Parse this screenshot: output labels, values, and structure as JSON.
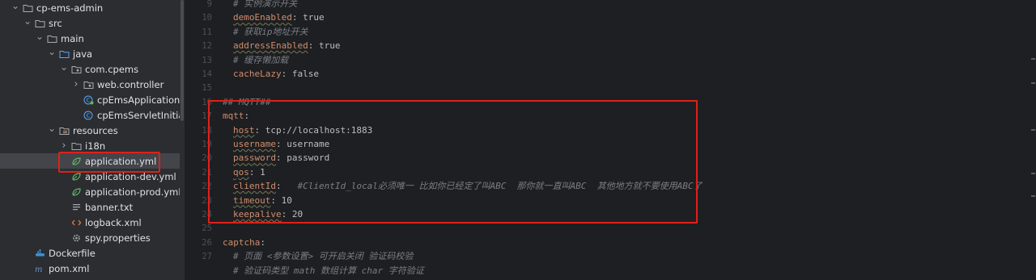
{
  "tree": {
    "items": [
      {
        "label": "cp-ems-admin",
        "depth": 0,
        "chevron": "down",
        "icon": "folder-module-icon"
      },
      {
        "label": "src",
        "depth": 1,
        "chevron": "down",
        "icon": "folder-icon"
      },
      {
        "label": "main",
        "depth": 2,
        "chevron": "down",
        "icon": "folder-icon"
      },
      {
        "label": "java",
        "depth": 3,
        "chevron": "down",
        "icon": "folder-source-icon"
      },
      {
        "label": "com.cpems",
        "depth": 4,
        "chevron": "down",
        "icon": "package-icon"
      },
      {
        "label": "web.controller",
        "depth": 5,
        "chevron": "right",
        "icon": "package-icon"
      },
      {
        "label": "cpEmsApplication",
        "depth": 5,
        "chevron": "",
        "icon": "spring-class-icon"
      },
      {
        "label": "cpEmsServletInitializer",
        "depth": 5,
        "chevron": "",
        "icon": "class-icon"
      },
      {
        "label": "resources",
        "depth": 3,
        "chevron": "down",
        "icon": "folder-resources-icon"
      },
      {
        "label": "i18n",
        "depth": 4,
        "chevron": "right",
        "icon": "folder-icon"
      },
      {
        "label": "application.yml",
        "depth": 4,
        "chevron": "",
        "icon": "yaml-spring-icon",
        "selected": true
      },
      {
        "label": "application-dev.yml",
        "depth": 4,
        "chevron": "",
        "icon": "yaml-spring-icon"
      },
      {
        "label": "application-prod.yml",
        "depth": 4,
        "chevron": "",
        "icon": "yaml-spring-icon"
      },
      {
        "label": "banner.txt",
        "depth": 4,
        "chevron": "",
        "icon": "text-file-icon"
      },
      {
        "label": "logback.xml",
        "depth": 4,
        "chevron": "",
        "icon": "xml-file-icon"
      },
      {
        "label": "spy.properties",
        "depth": 4,
        "chevron": "",
        "icon": "properties-file-icon"
      },
      {
        "label": "Dockerfile",
        "depth": 1,
        "chevron": "",
        "icon": "docker-icon"
      },
      {
        "label": "pom.xml",
        "depth": 1,
        "chevron": "",
        "icon": "maven-icon"
      }
    ]
  },
  "editor": {
    "line_numbers": [
      "9",
      "10",
      "11",
      "12",
      "13",
      "14",
      "15",
      "16",
      "17",
      "18",
      "19",
      "20",
      "21",
      "22",
      "23",
      "24",
      "25",
      "26",
      "27"
    ],
    "lines": [
      {
        "tokens": [
          {
            "t": "# 实例演示开关",
            "c": "c"
          }
        ],
        "indent": 1
      },
      {
        "tokens": [
          {
            "t": "demoEnabled",
            "c": "k"
          },
          {
            "t": ": true",
            "c": "v"
          }
        ],
        "indent": 1
      },
      {
        "tokens": [
          {
            "t": "# 获取ip地址开关",
            "c": "c"
          }
        ],
        "indent": 1
      },
      {
        "tokens": [
          {
            "t": "addressEnabled",
            "c": "k"
          },
          {
            "t": ": true",
            "c": "v"
          }
        ],
        "indent": 1
      },
      {
        "tokens": [
          {
            "t": "# 缓存懒加载",
            "c": "c"
          }
        ],
        "indent": 1
      },
      {
        "tokens": [
          {
            "t": "cacheLazy",
            "c": "k2"
          },
          {
            "t": ": false",
            "c": "v"
          }
        ],
        "indent": 1
      },
      {
        "tokens": [],
        "indent": 0
      },
      {
        "tokens": [
          {
            "t": "## MQTT##",
            "c": "c"
          }
        ],
        "indent": 0
      },
      {
        "tokens": [
          {
            "t": "mqtt",
            "c": "k2"
          },
          {
            "t": ":",
            "c": "v"
          }
        ],
        "indent": 0
      },
      {
        "tokens": [
          {
            "t": "host",
            "c": "k"
          },
          {
            "t": ": tcp://localhost:1883",
            "c": "v"
          }
        ],
        "indent": 1
      },
      {
        "tokens": [
          {
            "t": "username",
            "c": "k"
          },
          {
            "t": ": username",
            "c": "v"
          }
        ],
        "indent": 1
      },
      {
        "tokens": [
          {
            "t": "password",
            "c": "k"
          },
          {
            "t": ": password",
            "c": "v"
          }
        ],
        "indent": 1
      },
      {
        "tokens": [
          {
            "t": "qos",
            "c": "k"
          },
          {
            "t": ": 1",
            "c": "v"
          }
        ],
        "indent": 1
      },
      {
        "tokens": [
          {
            "t": "clientId",
            "c": "k"
          },
          {
            "t": ":   ",
            "c": "v"
          },
          {
            "t": "#ClientId_local必须唯一 比如你已经定了叫ABC  那你就一直叫ABC  其他地方就不要使用ABC了",
            "c": "c"
          }
        ],
        "indent": 1
      },
      {
        "tokens": [
          {
            "t": "timeout",
            "c": "k"
          },
          {
            "t": ": 10",
            "c": "v"
          }
        ],
        "indent": 1
      },
      {
        "tokens": [
          {
            "t": "keepalive",
            "c": "k"
          },
          {
            "t": ": 20",
            "c": "v"
          }
        ],
        "indent": 1
      },
      {
        "tokens": [],
        "indent": 0
      },
      {
        "tokens": [
          {
            "t": "captcha",
            "c": "k2"
          },
          {
            "t": ":",
            "c": "v"
          }
        ],
        "indent": 0
      },
      {
        "tokens": [
          {
            "t": "# 页面 <参数设置> 可开启关闭 验证码校验",
            "c": "c"
          }
        ],
        "indent": 1
      },
      {
        "tokens": [
          {
            "t": "# 验证码类型 math 数组计算 char 字符验证",
            "c": "c"
          }
        ],
        "indent": 1
      }
    ]
  },
  "colors": {
    "highlight_box": "#e0201a",
    "editor_bg": "#1e1f22",
    "tree_bg": "#2b2d30"
  }
}
